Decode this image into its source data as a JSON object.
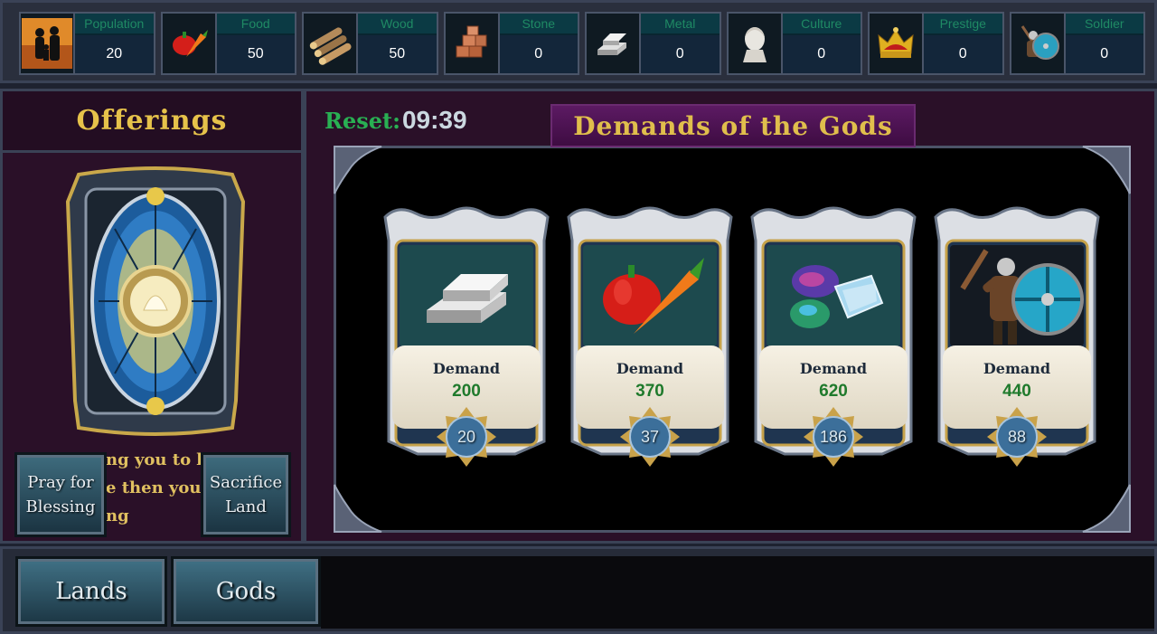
{
  "resources": [
    {
      "name": "Population",
      "value": "20",
      "icon": "population-icon"
    },
    {
      "name": "Food",
      "value": "50",
      "icon": "food-icon"
    },
    {
      "name": "Wood",
      "value": "50",
      "icon": "wood-icon"
    },
    {
      "name": "Stone",
      "value": "0",
      "icon": "stone-icon"
    },
    {
      "name": "Metal",
      "value": "0",
      "icon": "metal-icon"
    },
    {
      "name": "Culture",
      "value": "0",
      "icon": "culture-icon"
    },
    {
      "name": "Prestige",
      "value": "0",
      "icon": "crown-icon"
    },
    {
      "name": "Soldier",
      "value": "0",
      "icon": "soldier-icon"
    }
  ],
  "offerings": {
    "title": "Offerings",
    "text_lines": [
      "ng you to be",
      "e then you c",
      "ng"
    ],
    "pray_button": "Pray for Blessing",
    "sacrifice_button": "Sacrifice Land"
  },
  "gods": {
    "reset_label": "Reset:",
    "reset_time": "09:39",
    "title": "Demands of the Gods",
    "cards": [
      {
        "label": "Demand",
        "value": "200",
        "reward": "20",
        "icon": "metal-bars-icon"
      },
      {
        "label": "Demand",
        "value": "370",
        "reward": "37",
        "icon": "food-icon"
      },
      {
        "label": "Demand",
        "value": "620",
        "reward": "186",
        "icon": "gems-icon"
      },
      {
        "label": "Demand",
        "value": "440",
        "reward": "88",
        "icon": "soldier-icon"
      }
    ]
  },
  "nav": {
    "lands": "Lands",
    "gods": "Gods"
  },
  "colors": {
    "panel_bg": "#2a1028",
    "title_gold": "#e6c24a",
    "reset_green": "#29b053",
    "demand_green": "#1f7a2c"
  }
}
